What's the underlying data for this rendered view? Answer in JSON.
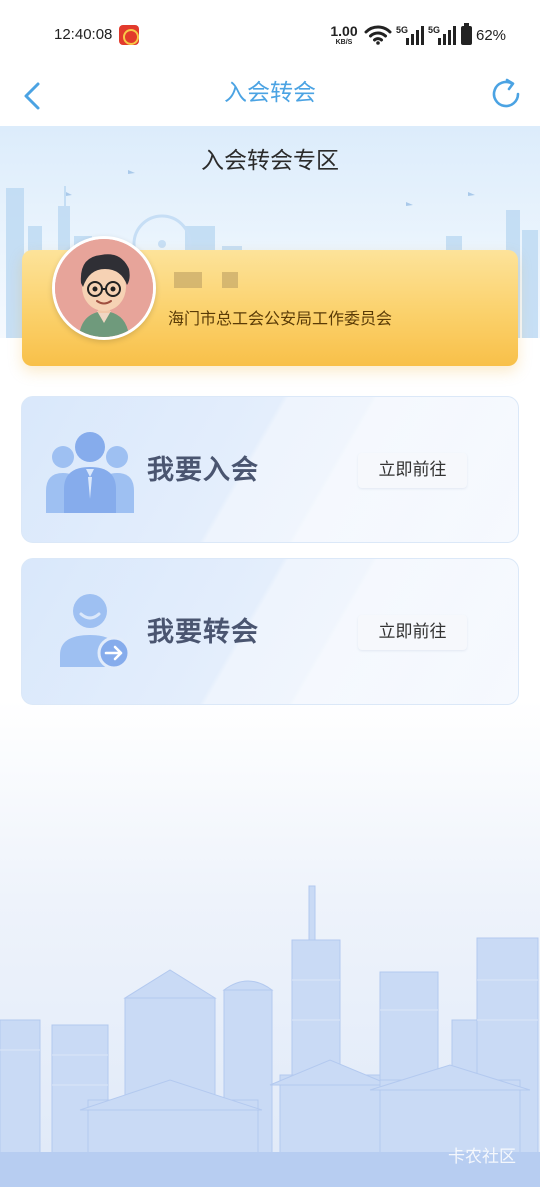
{
  "status_bar": {
    "time": "12:40:08",
    "speed_value": "1.00",
    "speed_unit": "KB/S",
    "signal1_label": "5G",
    "signal2_label": "5G",
    "battery": "62%"
  },
  "nav": {
    "title": "入会转会",
    "back_icon": "chevron-left-icon",
    "refresh_icon": "refresh-icon"
  },
  "banner": {
    "title": "入会转会专区"
  },
  "profile": {
    "organization": "海门市总工会公安局工作委员会"
  },
  "actions": [
    {
      "label": "我要入会",
      "button": "立即前往",
      "icon": "group-users-icon"
    },
    {
      "label": "我要转会",
      "button": "立即前往",
      "icon": "user-transfer-icon"
    }
  ],
  "watermark": "卡农社区",
  "colors": {
    "accent": "#4ba3e3",
    "card_gold": "#fbd16b",
    "card_blue": "#d9e8fb",
    "icon_blue": "#8fb5f0"
  }
}
